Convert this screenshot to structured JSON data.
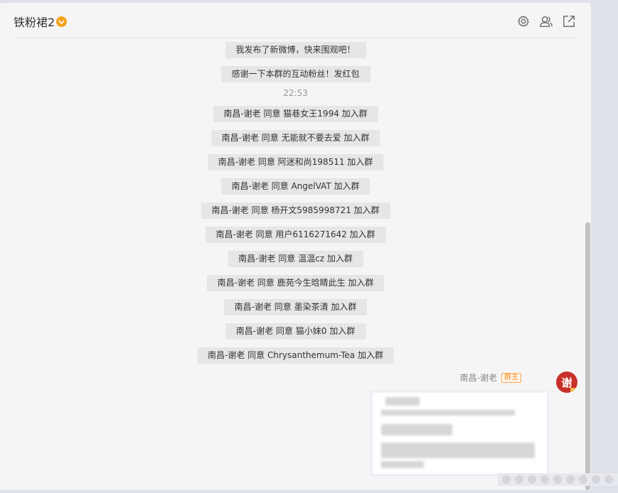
{
  "header": {
    "title": "铁粉裙2",
    "icons": [
      "settings-icon",
      "members-icon",
      "popout-icon"
    ]
  },
  "messages": {
    "system": [
      "我发布了新微博，快来围观吧！",
      "感谢一下本群的互动粉丝！发红包"
    ],
    "time": "22:53",
    "joins": [
      "南昌-谢老 同意 猫巷女王1994 加入群",
      "南昌-谢老 同意 无能就不要去爱 加入群",
      "南昌-谢老 同意 阿迷和尚198511 加入群",
      "南昌-谢老 同意 AngelVAT 加入群",
      "南昌-谢老 同意 杨开文5985998721 加入群",
      "南昌-谢老 同意 用户6116271642 加入群",
      "南昌-谢老 同意 温温cz 加入群",
      "南昌-谢老 同意 鹿苑今生晗睛此生 加入群",
      "南昌-谢老 同意 墨染茶清 加入群",
      "南昌-谢老 同意 猫小妹0 加入群",
      "南昌-谢老 同意 Chrysanthemum-Tea 加入群"
    ],
    "sender": {
      "name": "南昌-谢老",
      "role": "群主",
      "avatar_char": "谢"
    }
  },
  "colors": {
    "owner_badge": "#f28b1c",
    "avatar": "#c8302a",
    "verified_badge": "#f7a21b"
  }
}
